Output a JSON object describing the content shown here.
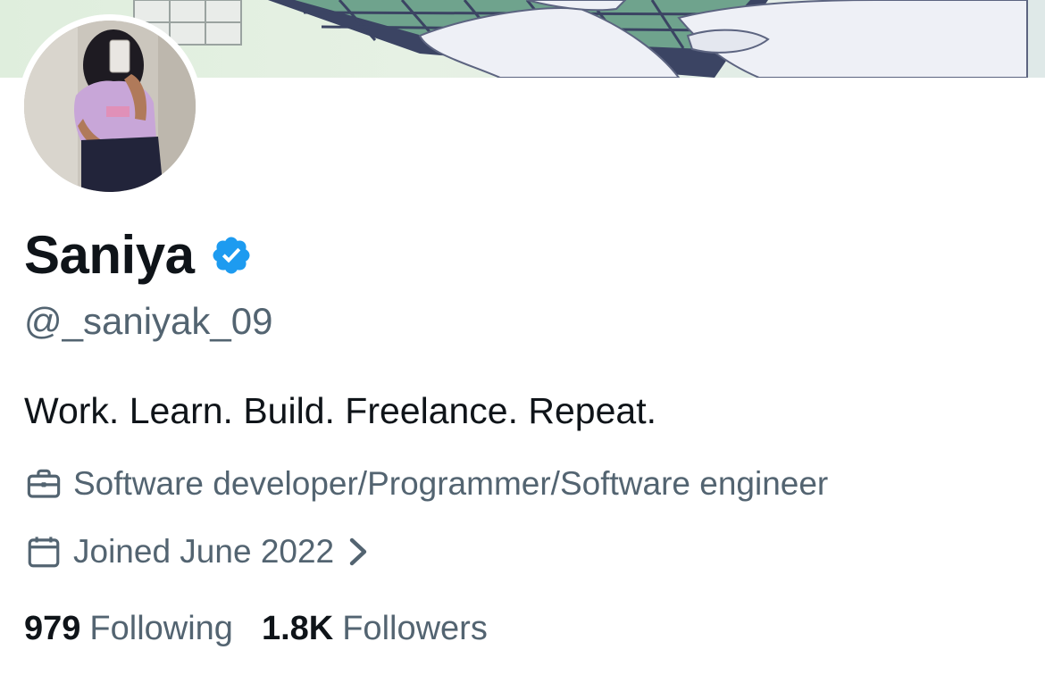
{
  "profile": {
    "display_name": "Saniya",
    "verified": true,
    "handle": "@_saniyak_09",
    "bio": "Work. Learn. Build. Freelance. Repeat.",
    "profession": "Software developer/Programmer/Software engineer",
    "joined": "Joined June 2022"
  },
  "stats": {
    "following_count": "979",
    "following_label": "Following",
    "followers_count": "1.8K",
    "followers_label": "Followers"
  },
  "icons": {
    "verified": "verified-badge-icon",
    "profession": "briefcase-icon",
    "joined": "calendar-icon",
    "joined_more": "chevron-right-icon"
  },
  "colors": {
    "text_primary": "#0f1419",
    "text_secondary": "#536471",
    "verified_blue": "#1d9bf0"
  }
}
